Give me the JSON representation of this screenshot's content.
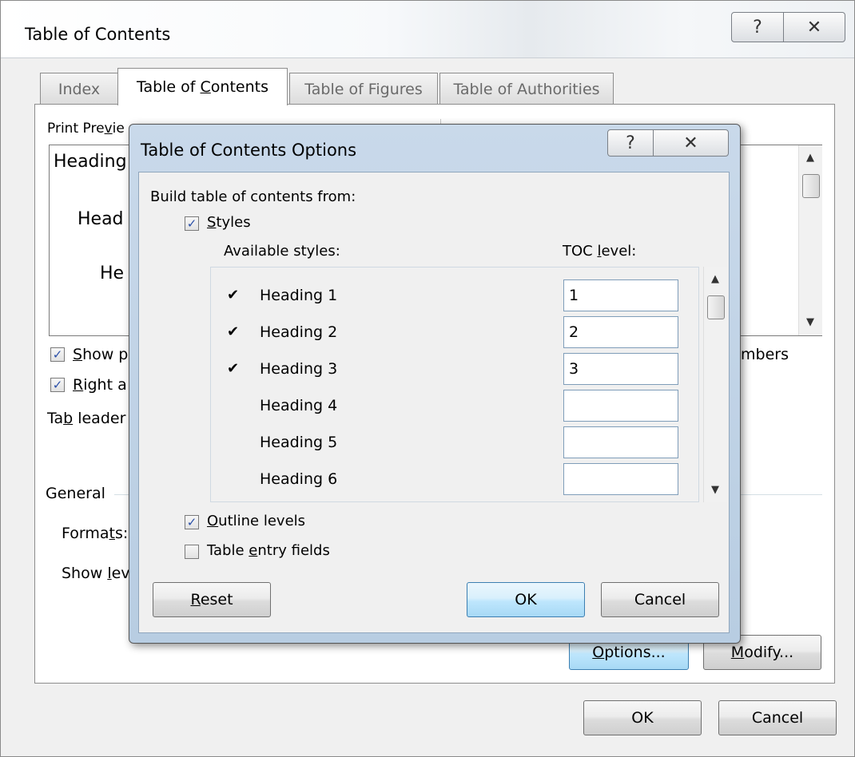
{
  "main": {
    "title": "Table of Contents",
    "help_glyph": "?",
    "close_glyph": "✕",
    "tabs": [
      {
        "label_pre": "Index",
        "label_key": "",
        "label_post": ""
      },
      {
        "label_pre": "Table of ",
        "label_key": "C",
        "label_post": "ontents"
      },
      {
        "label_pre": "Table of Figures",
        "label_key": "",
        "label_post": ""
      },
      {
        "label_pre": "Table of Authorities",
        "label_key": "",
        "label_post": ""
      }
    ],
    "print_preview_label_pre": "Print Pre",
    "print_preview_label_key": "v",
    "print_preview_label_post": "ie",
    "preview_lines": [
      "Heading",
      "Head",
      "He"
    ],
    "show_page_numbers": {
      "pre": "",
      "key": "S",
      "post": "how p",
      "checked": true
    },
    "right_align": {
      "pre": "",
      "key": "R",
      "post": "ight a",
      "checked": true
    },
    "tab_leader": {
      "pre": "Ta",
      "key": "b",
      "post": " leader"
    },
    "web_numbers_fragment": "mbers",
    "general_label": "General",
    "formats": {
      "pre": "Forma",
      "key": "t",
      "post": "s:"
    },
    "show_levels": {
      "pre": "Show ",
      "key": "l",
      "post": "ev"
    },
    "options_button": {
      "pre": "",
      "key": "O",
      "post": "ptions..."
    },
    "modify_button": {
      "pre": "",
      "key": "M",
      "post": "odify..."
    },
    "ok_button": "OK",
    "cancel_button": "Cancel"
  },
  "options": {
    "title": "Table of Contents Options",
    "help_glyph": "?",
    "close_glyph": "✕",
    "build_from": "Build table of contents from:",
    "styles": {
      "pre": "",
      "key": "S",
      "post": "tyles",
      "checked": true
    },
    "available_styles_label": "Available styles:",
    "toc_level_label": {
      "pre": "TOC ",
      "key": "l",
      "post": "evel:"
    },
    "style_rows": [
      {
        "name": "Heading 1",
        "checked": "✔",
        "level": "1"
      },
      {
        "name": "Heading 2",
        "checked": "✔",
        "level": "2"
      },
      {
        "name": "Heading 3",
        "checked": "✔",
        "level": "3"
      },
      {
        "name": "Heading 4",
        "checked": "",
        "level": ""
      },
      {
        "name": "Heading 5",
        "checked": "",
        "level": ""
      },
      {
        "name": "Heading 6",
        "checked": "",
        "level": ""
      }
    ],
    "outline_levels": {
      "pre": "",
      "key": "O",
      "post": "utline levels",
      "checked": true
    },
    "table_entry_fields": {
      "pre": "Table ",
      "key": "e",
      "post": "ntry fields",
      "checked": false
    },
    "reset_button": {
      "pre": "",
      "key": "R",
      "post": "eset"
    },
    "ok_button": "OK",
    "cancel_button": "Cancel"
  },
  "icons": {
    "checkbox_check": "✓",
    "scroll_up": "▲",
    "scroll_down": "▼"
  }
}
